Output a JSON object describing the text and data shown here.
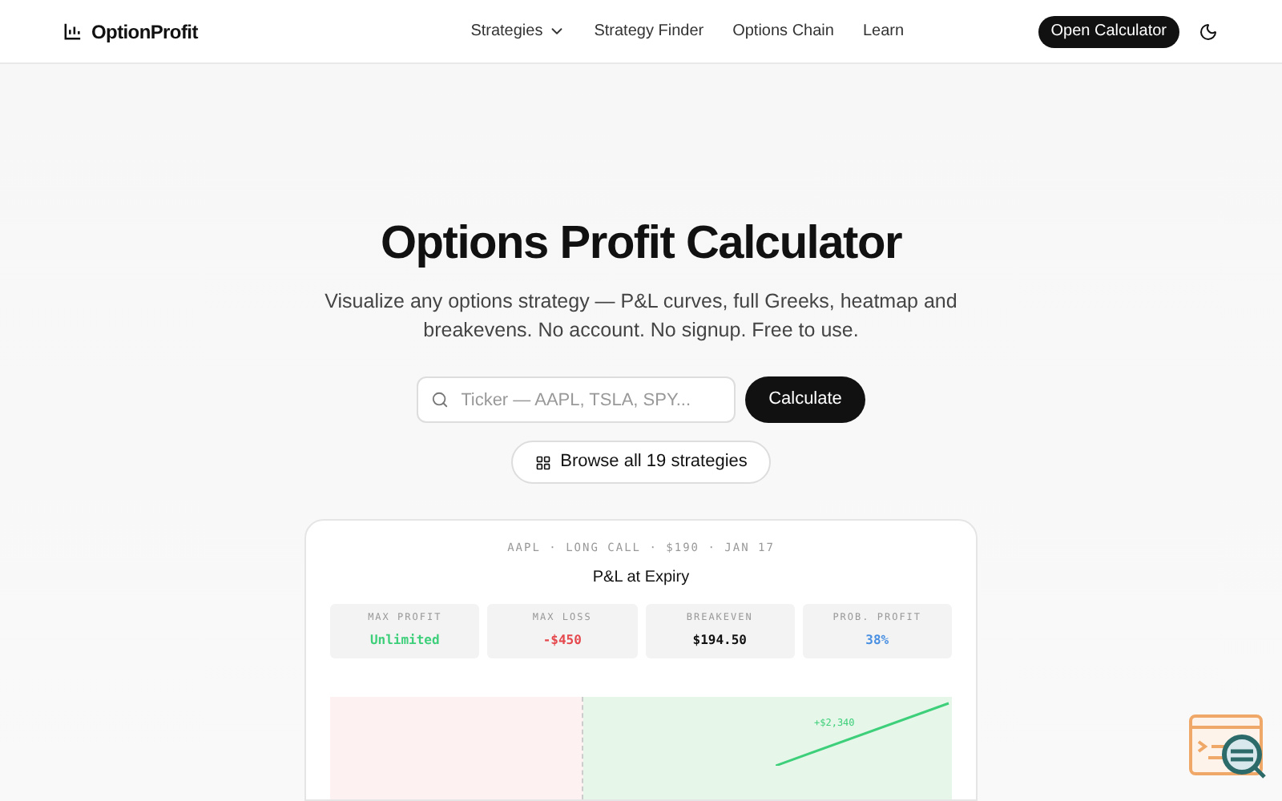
{
  "brand": "OptionProfit",
  "nav": [
    {
      "label": "Strategies",
      "kind": "dropdown"
    },
    {
      "label": "Strategy Finder",
      "kind": "link"
    },
    {
      "label": "Options Chain",
      "kind": "link"
    },
    {
      "label": "Learn",
      "kind": "link"
    }
  ],
  "header_button": "Open Calculator",
  "hero": {
    "title": "Options Profit Calculator",
    "subtitle": "Visualize any options strategy — P&L curves, full Greeks, heatmap and breakevens. No account. No signup. Free to use."
  },
  "search": {
    "placeholder": "Ticker — AAPL, TSLA, SPY...",
    "button": "Calculate"
  },
  "browse_button": "Browse all 19 strategies",
  "preview": {
    "meta": "AAPL · LONG CALL · $190 · JAN 17",
    "title": "P&L at Expiry",
    "stats": [
      {
        "label": "MAX PROFIT",
        "value": "Unlimited",
        "color": "#3ecf7a"
      },
      {
        "label": "MAX LOSS",
        "value": "-$450",
        "color": "#e5484d"
      },
      {
        "label": "BREAKEVEN",
        "value": "$194.50",
        "color": "#111111"
      },
      {
        "label": "PROB. PROFIT",
        "value": "38%",
        "color": "#4a90e2"
      }
    ],
    "chart_label": "+$2,340"
  }
}
